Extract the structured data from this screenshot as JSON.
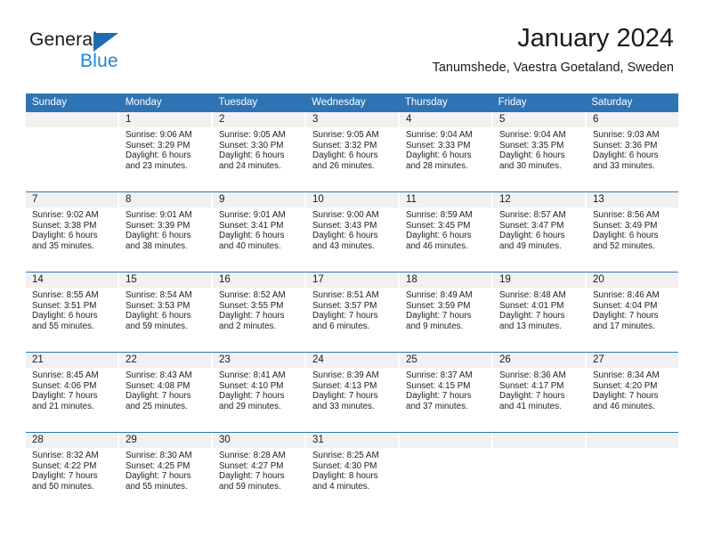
{
  "brand": {
    "name_primary": "General",
    "name_secondary": "Blue",
    "triangle_color": "#1b6cb0",
    "secondary_color": "#1e87d6"
  },
  "header": {
    "title": "January 2024",
    "subtitle": "Tanumshede, Vaestra Goetaland, Sweden"
  },
  "theme": {
    "header_bar_color": "#2e74b5",
    "day_band_color": "#f1f1f1",
    "text_color": "#222222"
  },
  "weekdays": [
    "Sunday",
    "Monday",
    "Tuesday",
    "Wednesday",
    "Thursday",
    "Friday",
    "Saturday"
  ],
  "weeks": [
    [
      {
        "day": "",
        "sunrise": "",
        "sunset": "",
        "daylight_line1": "",
        "daylight_line2": ""
      },
      {
        "day": "1",
        "sunrise": "Sunrise: 9:06 AM",
        "sunset": "Sunset: 3:29 PM",
        "daylight_line1": "Daylight: 6 hours",
        "daylight_line2": "and 23 minutes."
      },
      {
        "day": "2",
        "sunrise": "Sunrise: 9:05 AM",
        "sunset": "Sunset: 3:30 PM",
        "daylight_line1": "Daylight: 6 hours",
        "daylight_line2": "and 24 minutes."
      },
      {
        "day": "3",
        "sunrise": "Sunrise: 9:05 AM",
        "sunset": "Sunset: 3:32 PM",
        "daylight_line1": "Daylight: 6 hours",
        "daylight_line2": "and 26 minutes."
      },
      {
        "day": "4",
        "sunrise": "Sunrise: 9:04 AM",
        "sunset": "Sunset: 3:33 PM",
        "daylight_line1": "Daylight: 6 hours",
        "daylight_line2": "and 28 minutes."
      },
      {
        "day": "5",
        "sunrise": "Sunrise: 9:04 AM",
        "sunset": "Sunset: 3:35 PM",
        "daylight_line1": "Daylight: 6 hours",
        "daylight_line2": "and 30 minutes."
      },
      {
        "day": "6",
        "sunrise": "Sunrise: 9:03 AM",
        "sunset": "Sunset: 3:36 PM",
        "daylight_line1": "Daylight: 6 hours",
        "daylight_line2": "and 33 minutes."
      }
    ],
    [
      {
        "day": "7",
        "sunrise": "Sunrise: 9:02 AM",
        "sunset": "Sunset: 3:38 PM",
        "daylight_line1": "Daylight: 6 hours",
        "daylight_line2": "and 35 minutes."
      },
      {
        "day": "8",
        "sunrise": "Sunrise: 9:01 AM",
        "sunset": "Sunset: 3:39 PM",
        "daylight_line1": "Daylight: 6 hours",
        "daylight_line2": "and 38 minutes."
      },
      {
        "day": "9",
        "sunrise": "Sunrise: 9:01 AM",
        "sunset": "Sunset: 3:41 PM",
        "daylight_line1": "Daylight: 6 hours",
        "daylight_line2": "and 40 minutes."
      },
      {
        "day": "10",
        "sunrise": "Sunrise: 9:00 AM",
        "sunset": "Sunset: 3:43 PM",
        "daylight_line1": "Daylight: 6 hours",
        "daylight_line2": "and 43 minutes."
      },
      {
        "day": "11",
        "sunrise": "Sunrise: 8:59 AM",
        "sunset": "Sunset: 3:45 PM",
        "daylight_line1": "Daylight: 6 hours",
        "daylight_line2": "and 46 minutes."
      },
      {
        "day": "12",
        "sunrise": "Sunrise: 8:57 AM",
        "sunset": "Sunset: 3:47 PM",
        "daylight_line1": "Daylight: 6 hours",
        "daylight_line2": "and 49 minutes."
      },
      {
        "day": "13",
        "sunrise": "Sunrise: 8:56 AM",
        "sunset": "Sunset: 3:49 PM",
        "daylight_line1": "Daylight: 6 hours",
        "daylight_line2": "and 52 minutes."
      }
    ],
    [
      {
        "day": "14",
        "sunrise": "Sunrise: 8:55 AM",
        "sunset": "Sunset: 3:51 PM",
        "daylight_line1": "Daylight: 6 hours",
        "daylight_line2": "and 55 minutes."
      },
      {
        "day": "15",
        "sunrise": "Sunrise: 8:54 AM",
        "sunset": "Sunset: 3:53 PM",
        "daylight_line1": "Daylight: 6 hours",
        "daylight_line2": "and 59 minutes."
      },
      {
        "day": "16",
        "sunrise": "Sunrise: 8:52 AM",
        "sunset": "Sunset: 3:55 PM",
        "daylight_line1": "Daylight: 7 hours",
        "daylight_line2": "and 2 minutes."
      },
      {
        "day": "17",
        "sunrise": "Sunrise: 8:51 AM",
        "sunset": "Sunset: 3:57 PM",
        "daylight_line1": "Daylight: 7 hours",
        "daylight_line2": "and 6 minutes."
      },
      {
        "day": "18",
        "sunrise": "Sunrise: 8:49 AM",
        "sunset": "Sunset: 3:59 PM",
        "daylight_line1": "Daylight: 7 hours",
        "daylight_line2": "and 9 minutes."
      },
      {
        "day": "19",
        "sunrise": "Sunrise: 8:48 AM",
        "sunset": "Sunset: 4:01 PM",
        "daylight_line1": "Daylight: 7 hours",
        "daylight_line2": "and 13 minutes."
      },
      {
        "day": "20",
        "sunrise": "Sunrise: 8:46 AM",
        "sunset": "Sunset: 4:04 PM",
        "daylight_line1": "Daylight: 7 hours",
        "daylight_line2": "and 17 minutes."
      }
    ],
    [
      {
        "day": "21",
        "sunrise": "Sunrise: 8:45 AM",
        "sunset": "Sunset: 4:06 PM",
        "daylight_line1": "Daylight: 7 hours",
        "daylight_line2": "and 21 minutes."
      },
      {
        "day": "22",
        "sunrise": "Sunrise: 8:43 AM",
        "sunset": "Sunset: 4:08 PM",
        "daylight_line1": "Daylight: 7 hours",
        "daylight_line2": "and 25 minutes."
      },
      {
        "day": "23",
        "sunrise": "Sunrise: 8:41 AM",
        "sunset": "Sunset: 4:10 PM",
        "daylight_line1": "Daylight: 7 hours",
        "daylight_line2": "and 29 minutes."
      },
      {
        "day": "24",
        "sunrise": "Sunrise: 8:39 AM",
        "sunset": "Sunset: 4:13 PM",
        "daylight_line1": "Daylight: 7 hours",
        "daylight_line2": "and 33 minutes."
      },
      {
        "day": "25",
        "sunrise": "Sunrise: 8:37 AM",
        "sunset": "Sunset: 4:15 PM",
        "daylight_line1": "Daylight: 7 hours",
        "daylight_line2": "and 37 minutes."
      },
      {
        "day": "26",
        "sunrise": "Sunrise: 8:36 AM",
        "sunset": "Sunset: 4:17 PM",
        "daylight_line1": "Daylight: 7 hours",
        "daylight_line2": "and 41 minutes."
      },
      {
        "day": "27",
        "sunrise": "Sunrise: 8:34 AM",
        "sunset": "Sunset: 4:20 PM",
        "daylight_line1": "Daylight: 7 hours",
        "daylight_line2": "and 46 minutes."
      }
    ],
    [
      {
        "day": "28",
        "sunrise": "Sunrise: 8:32 AM",
        "sunset": "Sunset: 4:22 PM",
        "daylight_line1": "Daylight: 7 hours",
        "daylight_line2": "and 50 minutes."
      },
      {
        "day": "29",
        "sunrise": "Sunrise: 8:30 AM",
        "sunset": "Sunset: 4:25 PM",
        "daylight_line1": "Daylight: 7 hours",
        "daylight_line2": "and 55 minutes."
      },
      {
        "day": "30",
        "sunrise": "Sunrise: 8:28 AM",
        "sunset": "Sunset: 4:27 PM",
        "daylight_line1": "Daylight: 7 hours",
        "daylight_line2": "and 59 minutes."
      },
      {
        "day": "31",
        "sunrise": "Sunrise: 8:25 AM",
        "sunset": "Sunset: 4:30 PM",
        "daylight_line1": "Daylight: 8 hours",
        "daylight_line2": "and 4 minutes."
      },
      {
        "day": "",
        "sunrise": "",
        "sunset": "",
        "daylight_line1": "",
        "daylight_line2": ""
      },
      {
        "day": "",
        "sunrise": "",
        "sunset": "",
        "daylight_line1": "",
        "daylight_line2": ""
      },
      {
        "day": "",
        "sunrise": "",
        "sunset": "",
        "daylight_line1": "",
        "daylight_line2": ""
      }
    ]
  ]
}
